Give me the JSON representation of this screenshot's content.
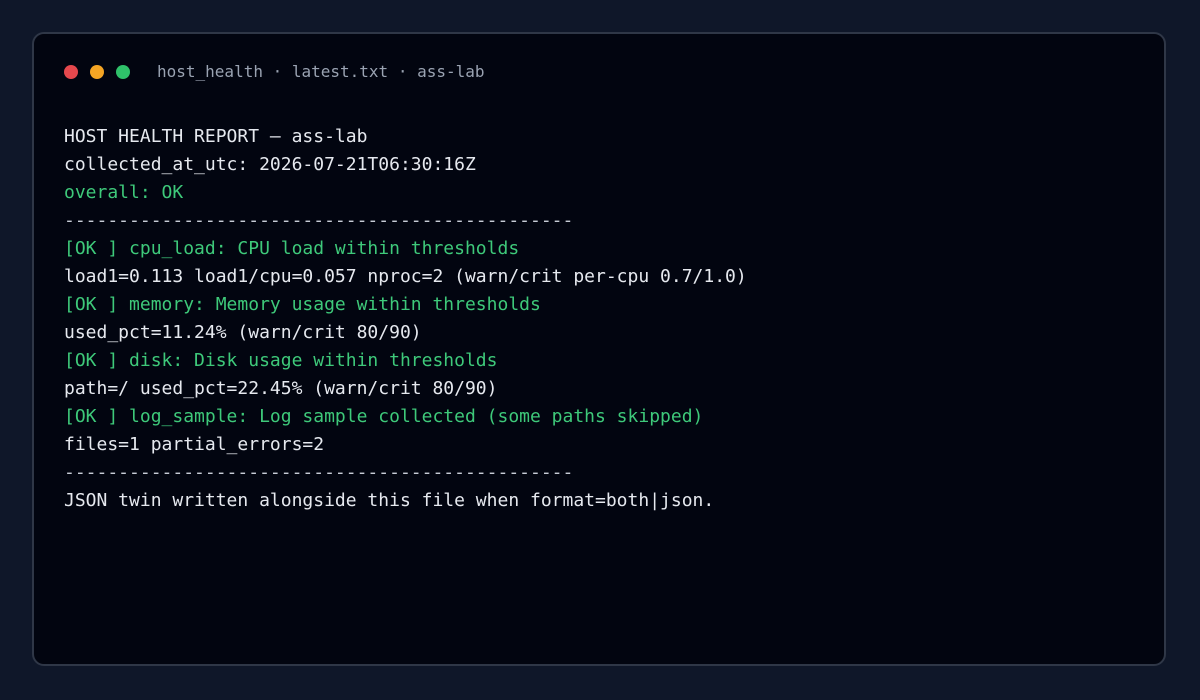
{
  "window": {
    "title": "host_health · latest.txt · ass-lab",
    "controls": {
      "close_color": "#e5484d",
      "minimize_color": "#f5a524",
      "maximize_color": "#2fc16a"
    }
  },
  "report": {
    "heading": "HOST HEALTH REPORT — ass-lab",
    "collected_at": "collected_at_utc: 2026-07-21T06:30:16Z",
    "overall": "overall: OK",
    "separator_top": "-----------------------------------------------",
    "checks": [
      {
        "status_line": "[OK ] cpu_load: CPU load within thresholds",
        "detail_line": "load1=0.113 load1/cpu=0.057 nproc=2 (warn/crit per-cpu 0.7/1.0)"
      },
      {
        "status_line": "[OK ] memory: Memory usage within thresholds",
        "detail_line": "used_pct=11.24% (warn/crit 80/90)"
      },
      {
        "status_line": "[OK ] disk: Disk usage within thresholds",
        "detail_line": "path=/ used_pct=22.45% (warn/crit 80/90)"
      },
      {
        "status_line": "[OK ] log_sample: Log sample collected (some paths skipped)",
        "detail_line": "files=1 partial_errors=2"
      }
    ],
    "separator_bottom": "-----------------------------------------------",
    "footer": "JSON twin written alongside this file when format=both|json."
  },
  "colors": {
    "ok": "#3ec97a",
    "text": "#e6e9ef",
    "title": "#9aa3b2",
    "background": "#020510"
  }
}
